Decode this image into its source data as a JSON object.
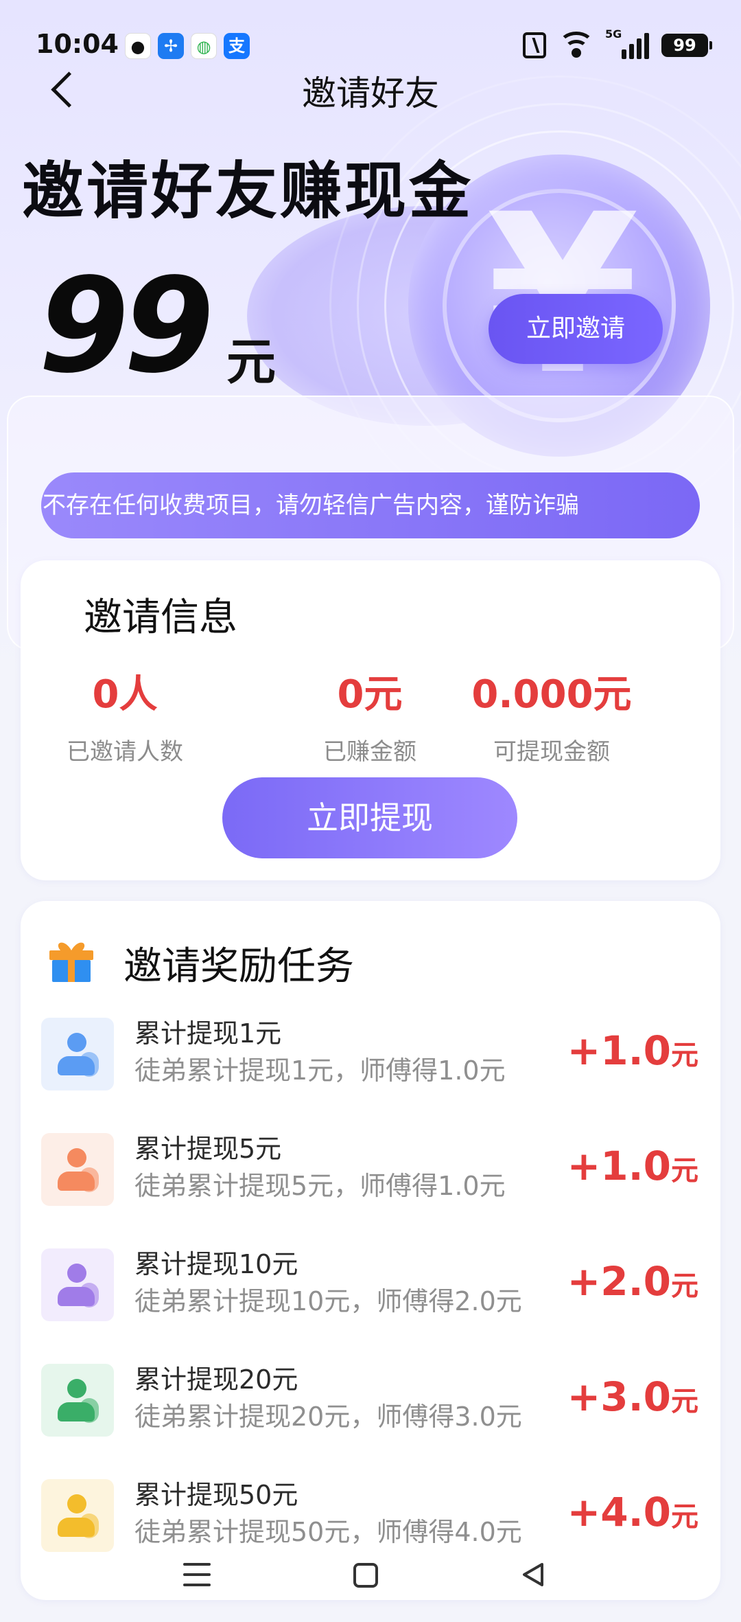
{
  "status_bar": {
    "time": "10:04",
    "app_icons": [
      {
        "name": "qq-icon",
        "glyph": "🐧",
        "bg": "#ffffff"
      },
      {
        "name": "pinwheel-app-icon",
        "glyph": "✢",
        "bg": "#1e7bf2"
      },
      {
        "name": "china-mobile-icon",
        "glyph": "◍",
        "bg": "#ffffff"
      },
      {
        "name": "alipay-icon",
        "glyph": "支",
        "bg": "#1677ff"
      }
    ],
    "signal_label": "5G",
    "battery": "99"
  },
  "nav": {
    "title": "邀请好友"
  },
  "hero": {
    "title": "邀请好友赚现金",
    "amount": "99",
    "unit": "元",
    "invite_button": "立即邀请"
  },
  "notice": {
    "text": "不存在任何收费项目，请勿轻信广告内容，谨防诈骗"
  },
  "invite_info": {
    "title": "邀请信息",
    "stats": [
      {
        "value": "0人",
        "label": "已邀请人数"
      },
      {
        "value": "0元",
        "label": "已赚金额"
      },
      {
        "value": "0.000元",
        "label": "可提现金额"
      }
    ],
    "withdraw_button": "立即提现"
  },
  "tasks": {
    "title": "邀请奖励任务",
    "items": [
      {
        "name": "累计提现1元",
        "desc": "徒弟累计提现1元，师傅得1.0元",
        "reward": "+1.0",
        "unit": "元",
        "icon_bg": "#eaf1fd",
        "icon_color": "#5b9cf3"
      },
      {
        "name": "累计提现5元",
        "desc": "徒弟累计提现5元，师傅得1.0元",
        "reward": "+1.0",
        "unit": "元",
        "icon_bg": "#fdeee7",
        "icon_color": "#f58a5f"
      },
      {
        "name": "累计提现10元",
        "desc": "徒弟累计提现10元，师傅得2.0元",
        "reward": "+2.0",
        "unit": "元",
        "icon_bg": "#f2ecfd",
        "icon_color": "#a07ce8"
      },
      {
        "name": "累计提现20元",
        "desc": "徒弟累计提现20元，师傅得3.0元",
        "reward": "+3.0",
        "unit": "元",
        "icon_bg": "#e6f6ec",
        "icon_color": "#3aae68"
      },
      {
        "name": "累计提现50元",
        "desc": "徒弟累计提现50元，师傅得4.0元",
        "reward": "+4.0",
        "unit": "元",
        "icon_bg": "#fdf4dd",
        "icon_color": "#f3bd2c"
      }
    ]
  },
  "colors": {
    "accent": "#6a55f2",
    "reward_red": "#e43d3d"
  }
}
